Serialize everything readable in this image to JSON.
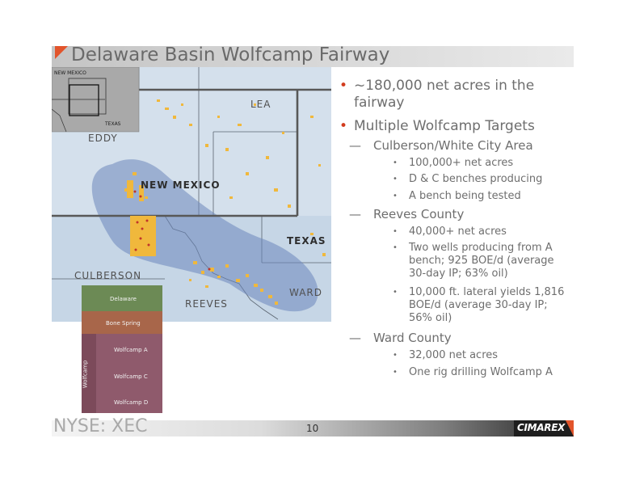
{
  "slide": {
    "title": "Delaware Basin Wolfcamp Fairway",
    "footer": "NYSE: XEC",
    "page_number": "10",
    "logo": "CIMAREX"
  },
  "map": {
    "inset": {
      "new_mexico": "NEW MEXICO",
      "texas": "TEXAS"
    },
    "labels": {
      "eddy": "EDDY",
      "lea": "LEA",
      "new_mexico": "NEW MEXICO",
      "texas": "TEXAS",
      "culberson": "CULBERSON",
      "reeves": "REEVES",
      "ward": "WARD"
    }
  },
  "stratigraphy": {
    "layers": [
      "Delaware",
      "Bone Spring",
      "Wolfcamp A",
      "Wolfcamp C",
      "Wolfcamp D"
    ],
    "group_label": "Wolfcamp"
  },
  "bullets": {
    "b1": "~180,000 net acres in the fairway",
    "b2": "Multiple Wolfcamp Targets",
    "culberson": {
      "heading": "Culberson/White City Area",
      "items": [
        "100,000+ net acres",
        "D & C benches producing",
        "A bench being tested"
      ]
    },
    "reeves": {
      "heading": "Reeves County",
      "items": [
        "40,000+ net acres",
        "Two wells producing from A bench; 925 BOE/d (average 30-day IP; 63% oil)",
        "10,000 ft. lateral yields 1,816 BOE/d (average 30-day IP; 56% oil)"
      ]
    },
    "ward": {
      "heading": "Ward County",
      "items": [
        "32,000 net acres",
        "One rig drilling Wolfcamp A"
      ]
    }
  }
}
